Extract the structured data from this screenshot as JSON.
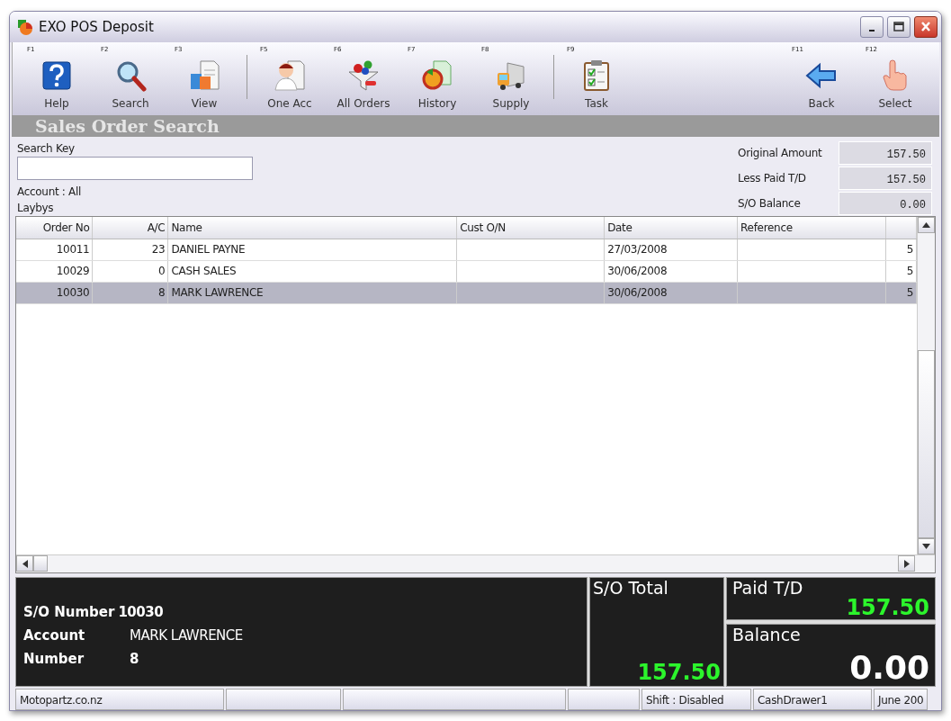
{
  "window": {
    "title": "EXO POS  Deposit"
  },
  "toolbar": {
    "groups": [
      [
        {
          "key": "F1",
          "label": "Help"
        },
        {
          "key": "F2",
          "label": "Search"
        },
        {
          "key": "F3",
          "label": "View"
        }
      ],
      [
        {
          "key": "F5",
          "label": "One Acc"
        },
        {
          "key": "F6",
          "label": "All Orders"
        },
        {
          "key": "F7",
          "label": "History"
        },
        {
          "key": "F8",
          "label": "Supply"
        }
      ],
      [
        {
          "key": "F9",
          "label": "Task"
        }
      ]
    ],
    "right": [
      {
        "key": "F11",
        "label": "Back"
      },
      {
        "key": "F12",
        "label": "Select"
      }
    ]
  },
  "section_title": "Sales Order Search",
  "search": {
    "label": "Search Key",
    "notes": [
      "Account : All",
      "Laybys"
    ]
  },
  "amounts": [
    {
      "label": "Original Amount",
      "value": "157.50"
    },
    {
      "label": "Less Paid T/D",
      "value": "157.50"
    },
    {
      "label": "S/O Balance",
      "value": "0.00"
    }
  ],
  "table": {
    "columns": [
      "Order No",
      "A/C",
      "Name",
      "Cust O/N",
      "Date",
      "Reference"
    ],
    "rows": [
      {
        "cells": [
          "10011",
          "23",
          "DANIEL PAYNE",
          "",
          "27/03/2008",
          "",
          "5"
        ],
        "selected": false
      },
      {
        "cells": [
          "10029",
          "0",
          "CASH SALES",
          "",
          "30/06/2008",
          "",
          "5"
        ],
        "selected": false
      },
      {
        "cells": [
          "10030",
          "8",
          "MARK LAWRENCE",
          "",
          "30/06/2008",
          "",
          "5"
        ],
        "selected": true
      }
    ]
  },
  "summary": {
    "fields": [
      {
        "label": "S/O Number",
        "value": "10030"
      },
      {
        "label": "Account",
        "value": "MARK LAWRENCE"
      },
      {
        "label": "Number",
        "value": "8"
      }
    ],
    "so_total": {
      "label": "S/O Total",
      "value": "157.50"
    },
    "paid": {
      "label": "Paid T/D",
      "value": "157.50"
    },
    "balance": {
      "label": "Balance",
      "value": "0.00"
    }
  },
  "status_bar": [
    {
      "kind": "text",
      "text": "Motopartz.co.nz"
    },
    {
      "kind": "blank"
    },
    {
      "kind": "blank"
    },
    {
      "kind": "blank"
    },
    {
      "kind": "text",
      "text": "Shift : Disabled"
    },
    {
      "kind": "text",
      "text": "CashDrawer1"
    },
    {
      "kind": "text",
      "text": "June 200"
    }
  ]
}
